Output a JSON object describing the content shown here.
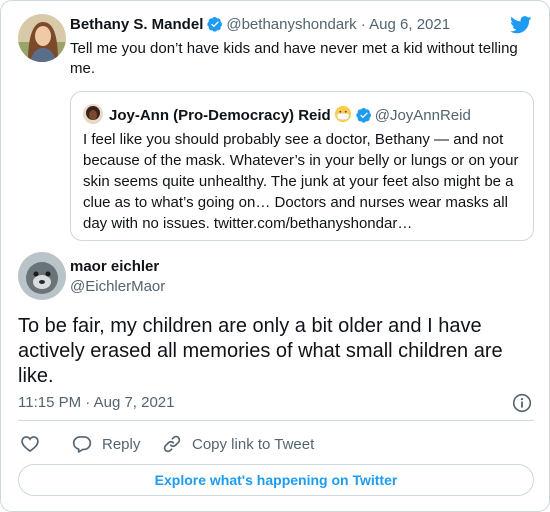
{
  "colors": {
    "brand": "#1d9bf0",
    "text": "#0f1419",
    "muted": "#536471",
    "border": "#cfd9de"
  },
  "parent_tweet": {
    "author_name": "Bethany S. Mandel",
    "handle_date": "@bethanyshondark · Aug 6, 2021",
    "text": "Tell me you don’t have kids and have never met a kid without telling me.",
    "quoted_tweet": {
      "author_name": "Joy-Ann (Pro-Democracy) Reid",
      "handle": "@JoyAnnReid",
      "text": "I feel like you should probably see a doctor, Bethany — and not because of the mask. Whatever’s in your belly or lungs or on your skin seems quite unhealthy. The junk at your feet also might be a clue as to what’s going on… Doctors and nurses wear masks all day with no issues. twitter.com/bethanyshondar…"
    }
  },
  "main_tweet": {
    "author_name": "maor eichler",
    "handle": "@EichlerMaor",
    "text": "To be fair, my children are only a bit older and I have actively erased all memories of what small children are like.",
    "timestamp": "11:15 PM · Aug 7, 2021"
  },
  "actions": {
    "reply_label": "Reply",
    "copy_link_label": "Copy link to Tweet"
  },
  "explore_label": "Explore what's happening on Twitter",
  "icons": [
    "twitter-bird-icon",
    "verified-badge-icon",
    "mask-face-emoji",
    "info-icon",
    "heart-icon",
    "reply-icon",
    "link-icon"
  ]
}
